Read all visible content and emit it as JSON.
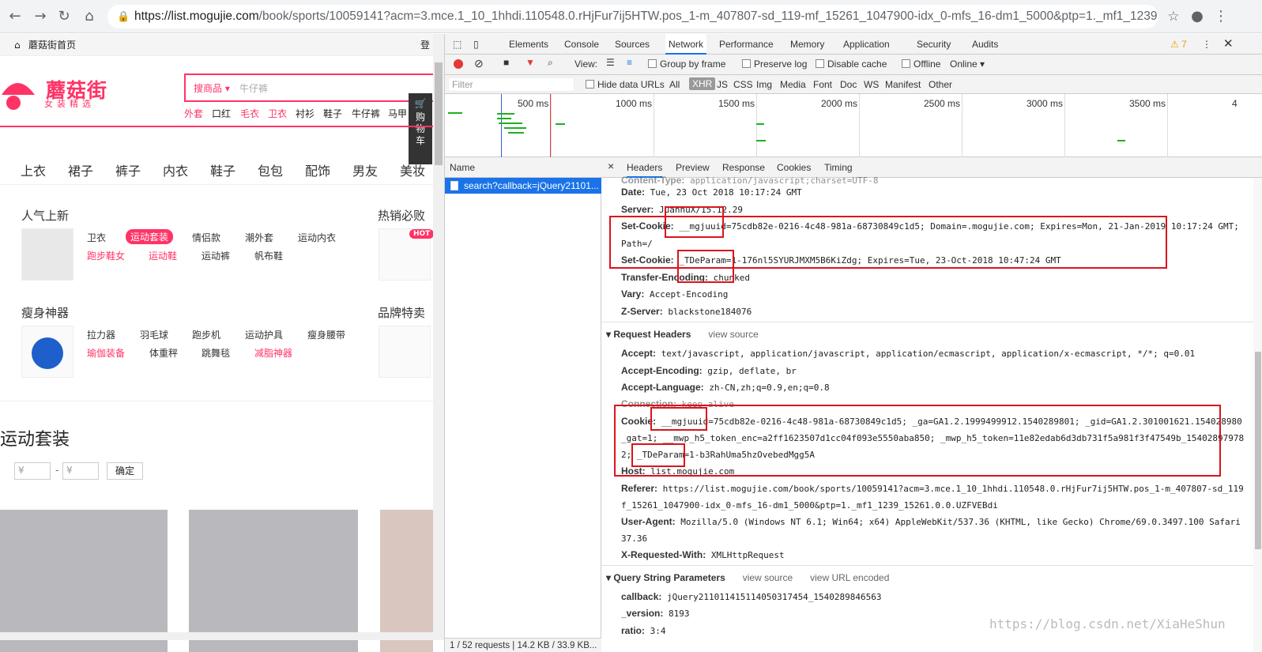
{
  "browser": {
    "url_host": "https://list.mogujie.com",
    "url_rest": "/book/sports/10059141?acm=3.mce.1_10_1hhdi.110548.0.rHjFur7ij5HTW.pos_1-m_407807-sd_119-mf_15261_1047900-idx_0-mfs_16-dm1_5000&ptp=1._mf1_1239_1526..."
  },
  "page": {
    "home_link": "蘑菇街首页",
    "login_text": "登",
    "logo_text": "蘑菇街",
    "logo_sub": "女装精选",
    "search_category": "搜商品 ▾",
    "search_placeholder": "牛仔裤",
    "hotwords": [
      "外套",
      "口红",
      "毛衣",
      "卫衣",
      "衬衫",
      "鞋子",
      "牛仔裤",
      "马甲"
    ],
    "cart_label": "购物车",
    "categories": [
      "上衣",
      "裙子",
      "裤子",
      "内衣",
      "鞋子",
      "包包",
      "配饰",
      "男友",
      "美妆"
    ],
    "section1_title": "人气上新",
    "section1_tags_row1": [
      "卫衣",
      "运动套装",
      "情侣款",
      "潮外套",
      "运动内衣"
    ],
    "section1_tags_row2": [
      "跑步鞋女",
      "运动鞋",
      "运动裤",
      "帆布鞋"
    ],
    "section2_title": "热销必败",
    "hot_badge": "HOT",
    "section3_title": "瘦身神器",
    "section3_tags_row1": [
      "拉力器",
      "羽毛球",
      "跑步机",
      "运动护具",
      "瘦身腰带"
    ],
    "section3_tags_row2": [
      "瑜伽装备",
      "体重秤",
      "跳舞毯",
      "减脂神器"
    ],
    "section4_title": "品牌特卖",
    "big_title": "运动套装",
    "price_from": "¥",
    "price_to": "¥",
    "price_dash": "-",
    "confirm_label": "确定"
  },
  "devtools": {
    "tabs": [
      "Elements",
      "Console",
      "Sources",
      "Network",
      "Performance",
      "Memory",
      "Application",
      "Security",
      "Audits"
    ],
    "warning_count": "⚠ 7",
    "toolbar": {
      "view_label": "View:",
      "group_by_frame": "Group by frame",
      "preserve_log": "Preserve log",
      "disable_cache": "Disable cache",
      "offline": "Offline",
      "online": "Online ▾"
    },
    "filter_placeholder": "Filter",
    "hide_data_urls": "Hide data URLs",
    "filter_types": [
      "All",
      "XHR",
      "JS",
      "CSS",
      "Img",
      "Media",
      "Font",
      "Doc",
      "WS",
      "Manifest",
      "Other"
    ],
    "timeline_labels": [
      "500 ms",
      "1000 ms",
      "1500 ms",
      "2000 ms",
      "2500 ms",
      "3000 ms",
      "3500 ms",
      "4"
    ],
    "name_header": "Name",
    "request_name": "search?callback=jQuery21101...",
    "status_bar": "1 / 52 requests  |  14.2 KB / 33.9 KB...",
    "detail_tabs": [
      "Headers",
      "Preview",
      "Response",
      "Cookies",
      "Timing"
    ],
    "response_headers": [
      {
        "k": "Content-Type:",
        "v": "application/javascript;charset=UTF-8"
      },
      {
        "k": "Date:",
        "v": "Tue, 23 Oct 2018 10:17:24 GMT"
      },
      {
        "k": "Server:",
        "v": "JuannuX/15.12.29"
      },
      {
        "k": "Set-Cookie:",
        "v": "__mgjuuid=75cdb82e-0216-4c48-981a-68730849c1d5; Domain=.mogujie.com; Expires=Mon, 21-Jan-2019 10:17:24 GMT;"
      },
      {
        "k": "",
        "v": "Path=/"
      },
      {
        "k": "Set-Cookie:",
        "v": "_TDeParam=1-176nl5SYURJMXM5B6KiZdg; Expires=Tue, 23-Oct-2018 10:47:24 GMT"
      },
      {
        "k": "Transfer-Encoding:",
        "v": "chunked"
      },
      {
        "k": "Vary:",
        "v": "Accept-Encoding"
      },
      {
        "k": "Z-Server:",
        "v": "blackstone184076"
      }
    ],
    "request_section": "Request Headers",
    "view_source": "view source",
    "request_headers": [
      {
        "k": "Accept:",
        "v": "text/javascript, application/javascript, application/ecmascript, application/x-ecmascript, */*; q=0.01"
      },
      {
        "k": "Accept-Encoding:",
        "v": "gzip, deflate, br"
      },
      {
        "k": "Accept-Language:",
        "v": "zh-CN,zh;q=0.9,en;q=0.8"
      },
      {
        "k": "Connection:",
        "v": "keep-alive"
      },
      {
        "k": "Cookie:",
        "v": "__mgjuuid=75cdb82e-0216-4c48-981a-68730849c1d5; _ga=GA1.2.1999499912.1540289801; _gid=GA1.2.301001621.154028980"
      },
      {
        "k": "",
        "v": "_gat=1; __mwp_h5_token_enc=a2ff1623507d1cc04f093e5550aba850; _mwp_h5_token=11e82edab6d3db731f5a981f3f47549b_15402897978"
      },
      {
        "k": "",
        "v": "2; _TDeParam=1-b3RahUma5hzOvebedMgg5A"
      },
      {
        "k": "Host:",
        "v": "list.mogujie.com"
      },
      {
        "k": "Referer:",
        "v": "https://list.mogujie.com/book/sports/10059141?acm=3.mce.1_10_1hhdi.110548.0.rHjFur7ij5HTW.pos_1-m_407807-sd_119"
      },
      {
        "k": "",
        "v": "f_15261_1047900-idx_0-mfs_16-dm1_5000&ptp=1._mf1_1239_15261.0.0.UZFVEBdi"
      },
      {
        "k": "User-Agent:",
        "v": "Mozilla/5.0 (Windows NT 6.1; Win64; x64) AppleWebKit/537.36 (KHTML, like Gecko) Chrome/69.0.3497.100 Safari"
      },
      {
        "k": "",
        "v": "37.36"
      },
      {
        "k": "X-Requested-With:",
        "v": "XMLHttpRequest"
      }
    ],
    "query_section": "Query String Parameters",
    "view_url_encoded": "view URL encoded",
    "query_params": [
      {
        "k": "callback:",
        "v": "jQuery211011415114050317454_1540289846563"
      },
      {
        "k": "_version:",
        "v": "8193"
      },
      {
        "k": "ratio:",
        "v": "3:4"
      }
    ]
  },
  "watermark": "https://blog.csdn.net/XiaHeShun",
  "colors": {
    "accent": "#ff3366",
    "devtools_blue": "#1a73e8",
    "highlight_red": "#d9141e"
  }
}
